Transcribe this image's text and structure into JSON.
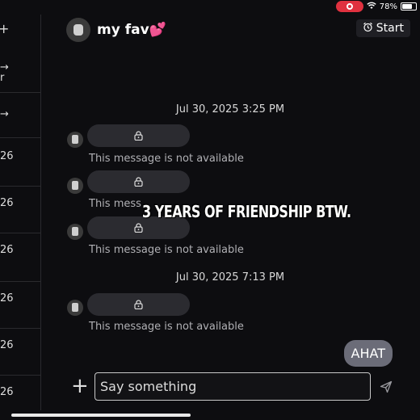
{
  "status_bar": {
    "battery": "78%",
    "battery_level": 0.78
  },
  "sidebar": {
    "top_icon": "+",
    "items": [
      {
        "line1": "→",
        "line2": "r"
      },
      {
        "line1": "→",
        "line2": ""
      },
      {
        "line1": "26",
        "line2": ""
      },
      {
        "line1": "26",
        "line2": ""
      },
      {
        "line1": "26",
        "line2": ""
      },
      {
        "line1": "26",
        "line2": ""
      },
      {
        "line1": "26",
        "line2": ""
      },
      {
        "line1": "26",
        "line2": ""
      }
    ]
  },
  "header": {
    "title": "my fav",
    "title_emoji": "💕",
    "start_label": "Start"
  },
  "messages": {
    "timestamp1": "Jul 30, 2025 3:25 PM",
    "timestamp2": "Jul 30, 2025 7:13 PM",
    "unavailable_text": "This message is not available",
    "partial_text": "This mess",
    "my_message": "AHAT"
  },
  "overlay_caption": "3 YEARS OF FRIENDSHIP BTW.",
  "composer": {
    "plus": "+",
    "placeholder": "Say something"
  },
  "colors": {
    "record": "#e0313f",
    "my_bubble": "#6b6c78",
    "background": "#0d0d10"
  }
}
